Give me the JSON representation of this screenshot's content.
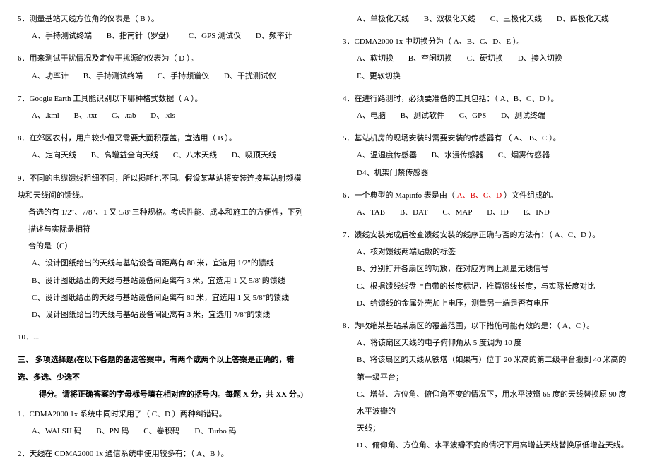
{
  "left": {
    "q5": {
      "text": "5．测量基站天线方位角的仪表是（  B  ）。",
      "a": "A、手持测试终端",
      "b": "B、指南针（罗盘）",
      "c": "C、GPS 测试仪",
      "d": "D、频率计"
    },
    "q6": {
      "text": "6．用来测试干扰情况及定位干扰源的仪表为（  D  ）。",
      "a": "A、功率计",
      "b": "B、手持测试终端",
      "c": "C、手持频谱仪",
      "d": "D、干扰测试仪"
    },
    "q7": {
      "text": "7．Google Earth 工具能识别以下哪种格式数据（ A    ）。",
      "a": "A、.kml",
      "b": "B、.txt",
      "c": "C、.tab",
      "d": "D、.xls"
    },
    "q8": {
      "text": "8．在郊区农村，用户较少但又需要大面积覆盖，宜选用（  B  ）。",
      "a": "A、定向天线",
      "b": "B、高增益全向天线",
      "c": "C、八木天线",
      "d": "D、吸顶天线"
    },
    "q9": {
      "line1": "9．不同的电缆馈线粗细不同，所以损耗也不同。假设某基站将安装连接基站射频模块和天线间的馈线。",
      "line2": "备选的有 1/2″、7/8″、1 又 5/8″三种规格。考虑性能、成本和施工的方便性，下列描述与实际最相符",
      "line3": "合的是（C）",
      "a": "A、设计图纸给出的天线与基站设备间距离有 80 米，宜选用 1/2″的馈线",
      "b": "B、设计图纸给出的天线与基站设备间距离有 3 米，宜选用 1 又 5/8″的馈线",
      "c": "C、设计图纸给出的天线与基站设备间距离有 80 米，宜选用 1 又 5/8″的馈线",
      "d": "D、设计图纸给出的天线与基站设备间距离有 3 米，宜选用 7/8″的馈线"
    },
    "q10": "10．...",
    "section3": {
      "title": "三、  多项选择题(在以下各题的备选答案中，有两个或两个以上答案是正确的，错选、多选、少选不",
      "title2": "得分。请将正确答案的字母标号填在相对应的括号内。每题 X 分，共 XX 分。)"
    },
    "mq1": {
      "text": "1．CDMA2000 1x 系统中同时采用了（    C、D    ）两种纠错码。",
      "a": "A、WALSH 码",
      "b": "B、PN 码",
      "c": "C、卷积码",
      "d": "D、Turbo 码"
    },
    "mq2": {
      "text": "2．天线在 CDMA2000 1x 通信系统中使用较多有：（   A、B    ）。"
    }
  },
  "right": {
    "mq2opts": {
      "a": "A、单极化天线",
      "b": "B、双极化天线",
      "c": "C、三极化天线",
      "d": "D、四极化天线"
    },
    "mq3": {
      "text": "3．CDMA2000 1x 中切换分为（   A、B、C、D、E    ）。",
      "a": "A、软切换",
      "b": "B、空闲切换",
      "c": "C、硬切换",
      "d": "D、接入切换",
      "e": "E、更软切换"
    },
    "mq4": {
      "text": "4．在进行路测时，必须要准备的工具包括：（   A、B、C、D    ）。",
      "a": "A、电脑",
      "b": "B、测试软件",
      "c": "C、GPS",
      "d": "D、测试终端"
    },
    "mq5": {
      "text": "5．基站机房的现场安装时需要安装的传感器有  （  A、 B、C    ）。",
      "a": "A、温湿度传感器",
      "b": "B、水浸传感器",
      "c": "C、烟雾传感器",
      "d": "D4、机架门禁传感器"
    },
    "mq6": {
      "prefix": "6．一个典型的 Mapinfo 表是由（     ",
      "answer": "A、B、C、D",
      "suffix": "  ）文件组成的。",
      "a": "A、TAB",
      "b": "B、DAT",
      "c": "C、MAP",
      "d": "D、ID",
      "e": "E、IND"
    },
    "mq7": {
      "text": "7．馈线安装完成后检查馈线安装的线序正确与否的方法有：（   A、C、D   ）。",
      "a": "A、核对馈线两端贴敷的标签",
      "b": "B、分别打开各扇区的功放，在对应方向上测量无线信号",
      "c": "C、根据馈线线盘上自带的长度标记，推算馈线长度，与实际长度对比",
      "d": "D、给馈线的金属外壳加上电压，测量另一端是否有电压"
    },
    "mq8": {
      "text": "8．为收缩某基站某扇区的覆盖范围，以下措施可能有效的是：（   A、C    ）。",
      "a": "A、将该扇区天线的电子俯仰角从 5 度调为 10 度",
      "b": "B、将该扇区的天线从铁塔（如果有）位于 20 米高的第二级平台搬到 40 米高的第一级平台；",
      "c": "C、增益、方位角、俯仰角不变的情况下，用水平波瓣 65 度的天线替换原 90 度水平波瓣的",
      "c2": "天线；",
      "d": "D 、俯仰角、方位角、水平波瓣不变的情况下用高增益天线替换原低增益天线。"
    }
  }
}
